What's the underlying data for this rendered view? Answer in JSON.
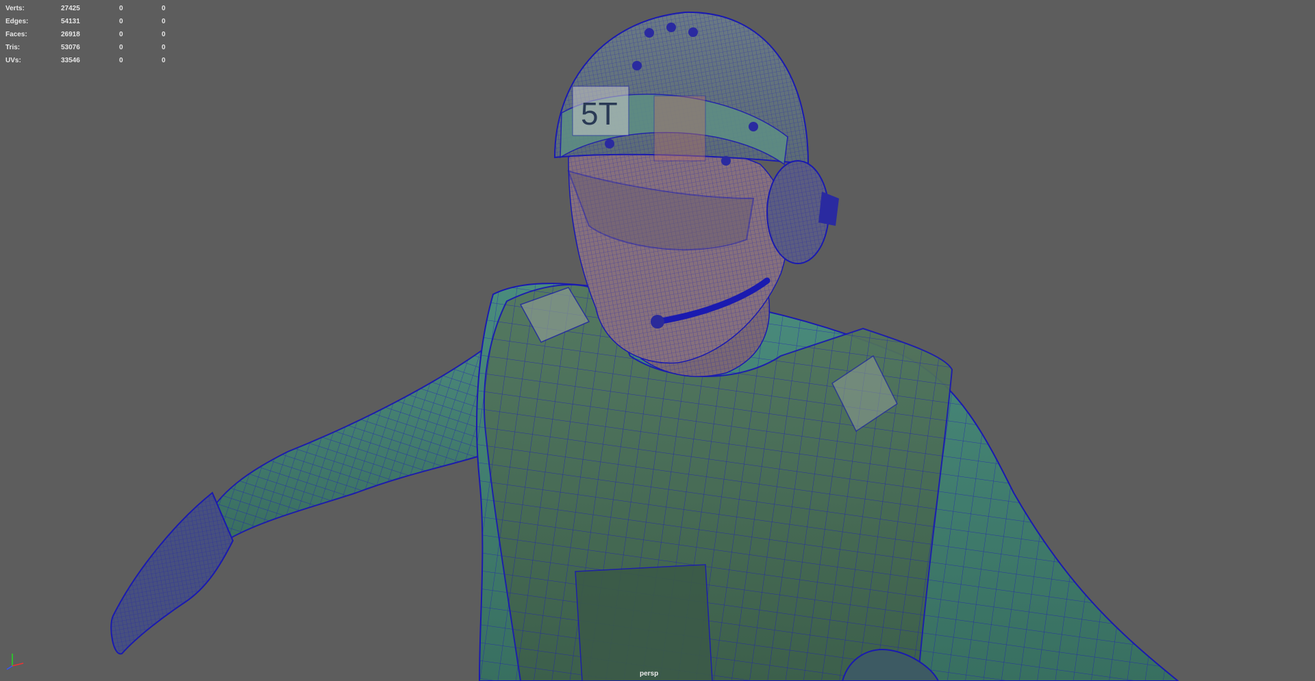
{
  "hud": {
    "rows": [
      {
        "label": "Verts:",
        "v1": "27425",
        "v2": "0",
        "v3": "0"
      },
      {
        "label": "Edges:",
        "v1": "54131",
        "v2": "0",
        "v3": "0"
      },
      {
        "label": "Faces:",
        "v1": "26918",
        "v2": "0",
        "v3": "0"
      },
      {
        "label": "Tris:",
        "v1": "53076",
        "v2": "0",
        "v3": "0"
      },
      {
        "label": "UVs:",
        "v1": "33546",
        "v2": "0",
        "v3": "0"
      }
    ]
  },
  "viewport": {
    "camera_label": "persp",
    "background_color": "#5d5d5d",
    "wire_color": "#1a1ab0",
    "body_color": "#3f7d6e"
  },
  "helmet": {
    "decal_text": "5T"
  },
  "icons": {
    "axis": "view-axis-gizmo-icon"
  }
}
